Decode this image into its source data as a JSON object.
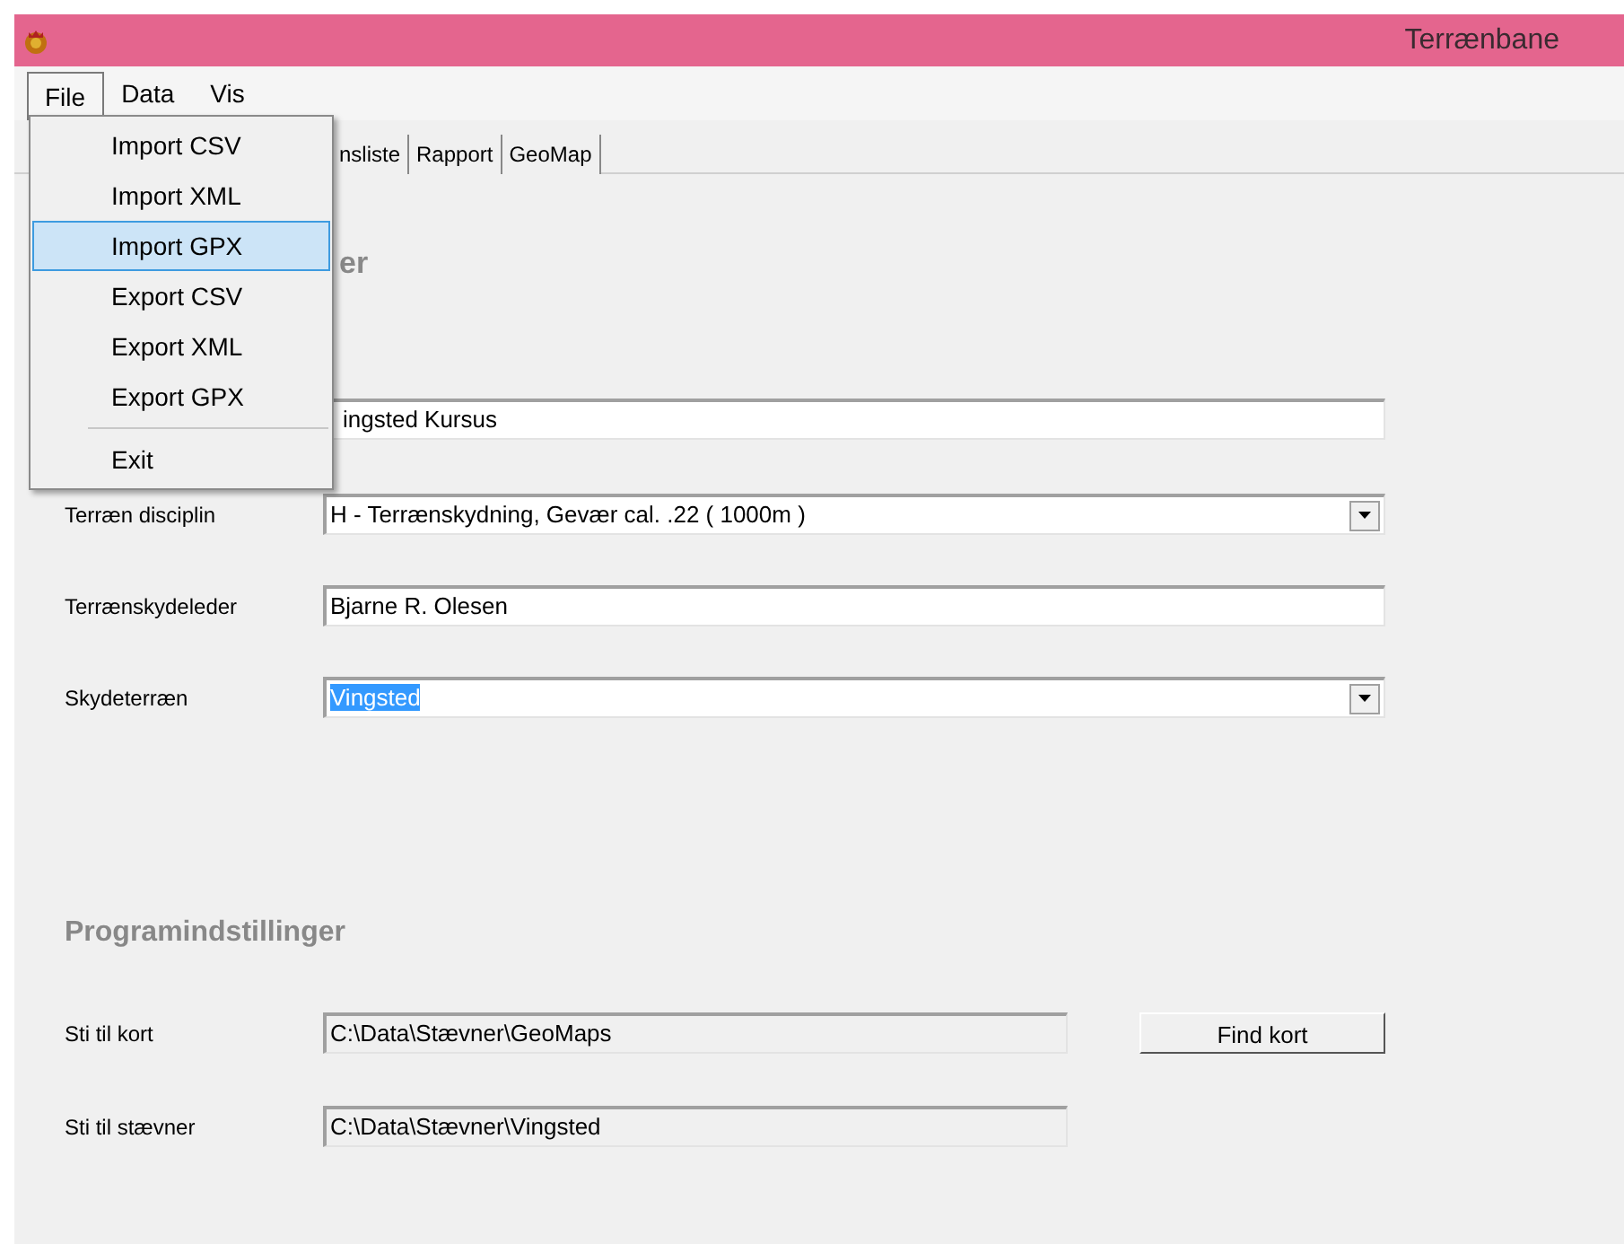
{
  "window": {
    "title": "Terrænbane"
  },
  "menubar": [
    {
      "label": "File",
      "selected": true
    },
    {
      "label": "Data",
      "selected": false
    },
    {
      "label": "Vis",
      "selected": false
    }
  ],
  "file_menu": [
    {
      "label": "Import CSV",
      "selected": false
    },
    {
      "label": "Import XML",
      "selected": false
    },
    {
      "label": "Import GPX",
      "selected": true
    },
    {
      "label": "Export CSV",
      "selected": false
    },
    {
      "label": "Export XML",
      "selected": false
    },
    {
      "label": "Export GPX",
      "selected": false
    },
    {
      "kind": "separator"
    },
    {
      "label": "Exit",
      "selected": false
    }
  ],
  "tabs": [
    {
      "label": "nsliste",
      "selected": false
    },
    {
      "label": "Rapport",
      "selected": false
    },
    {
      "label": "GeoMap",
      "selected": false
    }
  ],
  "section_heading": "er",
  "event_field": {
    "value": "ingsted Kursus"
  },
  "fields": [
    {
      "kind": "dropdown",
      "label": "Terræn disciplin",
      "value": "H  - Terrænskydning, Gevær cal. .22 ( 1000m )",
      "highlighted": false
    },
    {
      "kind": "text",
      "label": "Terrænskydeleder",
      "value": "Bjarne R. Olesen",
      "highlighted": false
    },
    {
      "kind": "dropdown",
      "label": "Skydeterræn",
      "value": "Vingsted",
      "highlighted": true
    }
  ],
  "settings": {
    "heading": "Programindstillinger",
    "rows": [
      {
        "label": "Sti til kort",
        "value": "C:\\Data\\Stævner\\GeoMaps",
        "button": "Find kort"
      },
      {
        "label": "Sti til stævner",
        "value": "C:\\Data\\Stævner\\Vingsted"
      }
    ]
  }
}
